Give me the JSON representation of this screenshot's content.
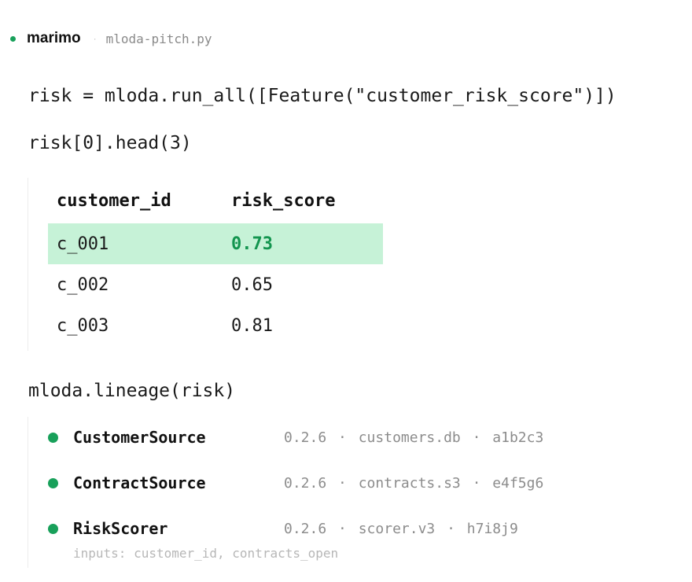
{
  "header": {
    "app_name": "marimo",
    "separator": "·",
    "filename": "mloda-pitch.py"
  },
  "cells": {
    "line1": "risk = mloda.run_all([Feature(\"customer_risk_score\")])",
    "line2": "risk[0].head(3)",
    "line3": "mloda.lineage(risk)"
  },
  "table": {
    "columns": [
      "customer_id",
      "risk_score"
    ],
    "rows": [
      {
        "customer_id": "c_001",
        "risk_score": "0.73",
        "highlighted": true
      },
      {
        "customer_id": "c_002",
        "risk_score": "0.65",
        "highlighted": false
      },
      {
        "customer_id": "c_003",
        "risk_score": "0.81",
        "highlighted": false
      }
    ]
  },
  "lineage": {
    "items": [
      {
        "name": "CustomerSource",
        "version": "0.2.6",
        "source": "customers.db",
        "hash": "a1b2c3"
      },
      {
        "name": "ContractSource",
        "version": "0.2.6",
        "source": "contracts.s3",
        "hash": "e4f5g6"
      },
      {
        "name": "RiskScorer",
        "version": "0.2.6",
        "source": "scorer.v3",
        "hash": "h7i8j9",
        "inputs": "inputs: customer_id, contracts_open"
      }
    ],
    "meta_separator": "·"
  },
  "colors": {
    "accent": "#18a05a",
    "highlight_row": "#c6f2d7",
    "highlight_text": "#13954f",
    "muted_text": "#8c8c8c"
  },
  "icons": {
    "status": "status-dot-icon",
    "lineage_node": "lineage-node-dot-icon"
  }
}
